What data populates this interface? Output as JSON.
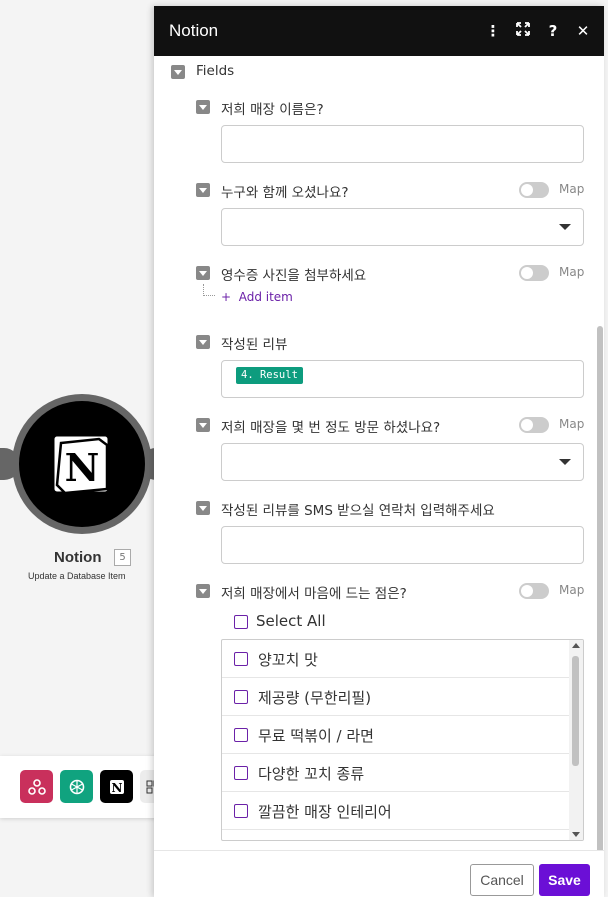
{
  "panel": {
    "title": "Notion",
    "header_icons": [
      "more-vert-icon",
      "expand-icon",
      "help-icon",
      "close-icon"
    ]
  },
  "module": {
    "name": "Notion",
    "count": "5",
    "subtitle": "Update a Database Item"
  },
  "fields_section": {
    "label": "Fields"
  },
  "fields": {
    "store_name": {
      "label": "저희 매장 이름은?",
      "value": ""
    },
    "companion": {
      "label": "누구와 함께 오셨나요?",
      "map": "Map"
    },
    "receipt": {
      "label": "영수증 사진을 첨부하세요",
      "map": "Map",
      "add_item": "Add item"
    },
    "review": {
      "label": "작성된 리뷰",
      "pill": "4. Result"
    },
    "visits": {
      "label": "저희 매장을 몇 번 정도 방문 하셨나요?",
      "map": "Map"
    },
    "sms": {
      "label": "작성된 리뷰를 SMS 받으실 연락처 입력해주세요",
      "value": ""
    },
    "likes": {
      "label": "저희 매장에서 마음에 드는 점은?",
      "map": "Map",
      "select_all": "Select All",
      "options": [
        "양꼬치 맛",
        "제공량 (무한리필)",
        "무료 떡볶이 / 라면",
        "다양한 꼬치 종류",
        "깔끔한 매장 인테리어"
      ]
    }
  },
  "footer": {
    "cancel_label": "Cancel",
    "save_label": "Save"
  },
  "toolbar": {
    "items": [
      "webhook-icon",
      "openai-icon",
      "notion-icon",
      "more-icon"
    ]
  },
  "colors": {
    "accent": "#6b0fd6",
    "pill": "#0d9c7e",
    "webhook": "#c9305c",
    "openai": "#10a37f"
  }
}
